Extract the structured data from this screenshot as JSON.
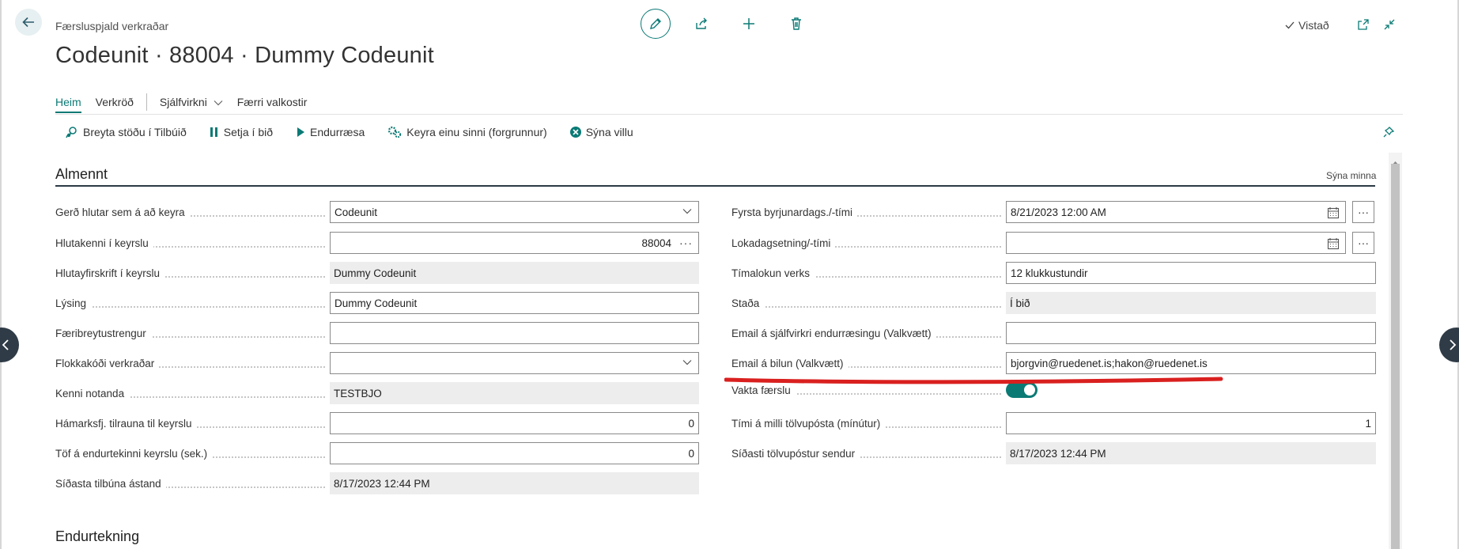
{
  "header": {
    "breadcrumb": "Færsluspjald verkraðar",
    "title": "Codeunit · 88004 · Dummy Codeunit",
    "saved_label": "Vistað"
  },
  "nav": {
    "tabs": [
      "Heim",
      "Verkröð",
      "Sjálfvirkni",
      "Færri valkostir"
    ]
  },
  "actions": [
    {
      "label": "Breyta stöðu í Tilbúið",
      "icon": "status-change-icon"
    },
    {
      "label": "Setja í bið",
      "icon": "pause-icon"
    },
    {
      "label": "Endurræsa",
      "icon": "play-icon"
    },
    {
      "label": "Keyra einu sinni (forgrunnur)",
      "icon": "run-gears-icon"
    },
    {
      "label": "Sýna villu",
      "icon": "error-icon"
    }
  ],
  "section": {
    "title": "Almennt",
    "show_less": "Sýna minna",
    "next_title": "Endurtekning"
  },
  "fields_left": [
    {
      "label": "Gerð hlutar sem á að keyra",
      "value": "Codeunit"
    },
    {
      "label": "Hlutakenni í keyrslu",
      "value": "88004"
    },
    {
      "label": "Hlutayfirskrift í keyrslu",
      "value": "Dummy Codeunit"
    },
    {
      "label": "Lýsing",
      "value": "Dummy Codeunit"
    },
    {
      "label": "Færibreytustrengur",
      "value": ""
    },
    {
      "label": "Flokkakóði verkraðar",
      "value": ""
    },
    {
      "label": "Kenni notanda",
      "value": "TESTBJO"
    },
    {
      "label": "Hámarksfj. tilrauna til keyrslu",
      "value": "0"
    },
    {
      "label": "Töf á endurtekinni keyrslu (sek.)",
      "value": "0"
    },
    {
      "label": "Síðasta tilbúna ástand",
      "value": "8/17/2023 12:44 PM"
    }
  ],
  "fields_right": [
    {
      "label": "Fyrsta byrjunardags./-tími",
      "value": "8/21/2023 12:00 AM"
    },
    {
      "label": "Lokadagsetning/-tími",
      "value": ""
    },
    {
      "label": "Tímalokun verks",
      "value": "12 klukkustundir"
    },
    {
      "label": "Staða",
      "value": "Í bið"
    },
    {
      "label": "Email á sjálfvirkri endurræsingu (Valkvætt)",
      "value": ""
    },
    {
      "label": "Email á bilun (Valkvætt)",
      "value": "bjorgvin@ruedenet.is;hakon@ruedenet.is"
    },
    {
      "label": "Vakta færslu",
      "value": ""
    },
    {
      "label": "Tími á milli tölvupósta (mínútur)",
      "value": "1"
    },
    {
      "label": "Síðasti tölvupóstur sendur",
      "value": "8/17/2023 12:44 PM"
    }
  ],
  "toggle_on": true,
  "colors": {
    "accent": "#0b7a75",
    "annotation": "#d9201f",
    "side_nav": "#2f3b46"
  }
}
